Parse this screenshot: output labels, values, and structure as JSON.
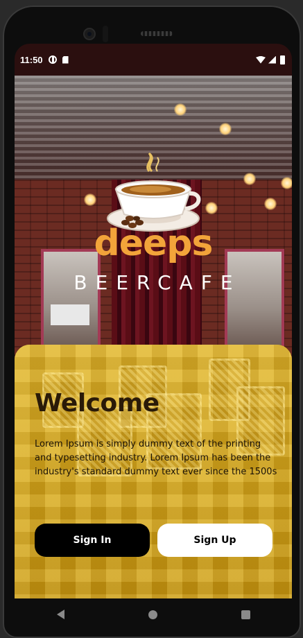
{
  "status_bar": {
    "time": "11:50"
  },
  "logo": {
    "brand": "deeps",
    "subtitle": "BEERCAFE",
    "brand_color": "#f2a43a"
  },
  "welcome": {
    "title": "Welcome",
    "body": "Lorem Ipsum is simply dummy text of the printing and typesetting industry. Lorem Ipsum has been the industry's standard dummy text ever since the 1500s"
  },
  "buttons": {
    "sign_in": "Sign In",
    "sign_up": "Sign Up"
  },
  "icons": {
    "status_left": [
      "data-saver-icon",
      "sd-card-icon"
    ],
    "status_right": [
      "wifi-icon",
      "signal-icon",
      "battery-icon"
    ],
    "logo": "coffee-cup-icon",
    "nav": [
      "back-icon",
      "home-icon",
      "recents-icon"
    ]
  },
  "colors": {
    "panel": "#d4a91e",
    "sign_in_bg": "#000000",
    "sign_up_bg": "#ffffff"
  }
}
